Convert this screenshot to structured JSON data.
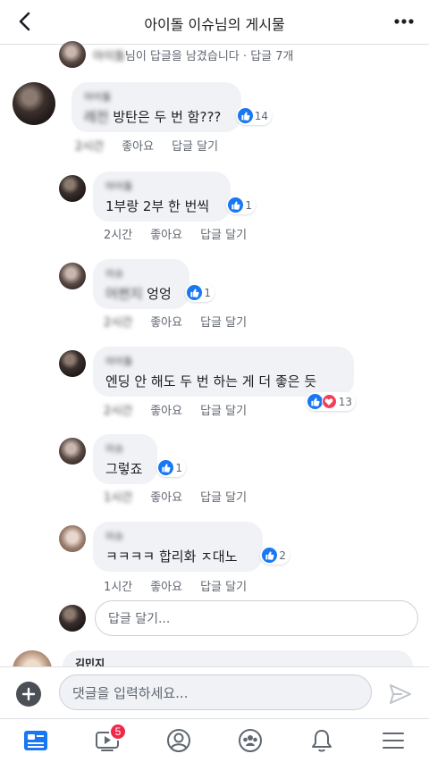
{
  "header": {
    "title": "아이돌 이슈님의 게시물"
  },
  "notice": {
    "blurred_name": "아이돌",
    "text": "님이 답글을 남겼습니다",
    "separator": "·",
    "replies": "답글 7개"
  },
  "comments": [
    {
      "name": "아이돌",
      "text_blur": "레전",
      "text": " 방탄은 두 번 함???",
      "reaction_count": "14",
      "reactions": [
        "like"
      ],
      "time": "2시간",
      "like_label": "좋아요",
      "reply_label": "답글 달기"
    },
    {
      "name": "아이돌",
      "text": "1부랑 2부 한 번씩",
      "reaction_count": "1",
      "reactions": [
        "like"
      ],
      "time": "2시간",
      "like_label": "좋아요",
      "reply_label": "답글 달기"
    },
    {
      "name": "이슈",
      "text_blur": "어쩐지",
      "text": " 엉엉",
      "reaction_count": "1",
      "reactions": [
        "like"
      ],
      "time": "2시간",
      "like_label": "좋아요",
      "reply_label": "답글 달기"
    },
    {
      "name": "아이돌",
      "text": "엔딩 안 해도 두 번 하는 게 더 좋은 듯",
      "reaction_count": "13",
      "reactions": [
        "like",
        "love"
      ],
      "time": "2시간",
      "like_label": "좋아요",
      "reply_label": "답글 달기"
    },
    {
      "name": "이슈",
      "text": "그렇죠",
      "reaction_count": "1",
      "reactions": [
        "like"
      ],
      "time": "1시간",
      "like_label": "좋아요",
      "reply_label": "답글 달기"
    },
    {
      "name": "이슈",
      "text": "ㅋㅋㅋㅋ 합리화 ㅈ대노",
      "reaction_count": "2",
      "reactions": [
        "like"
      ],
      "time": "1시간",
      "like_label": "좋아요",
      "reply_label": "답글 달기"
    }
  ],
  "reply_input": {
    "placeholder": "답글 달기..."
  },
  "next_comment": {
    "name": "김민지"
  },
  "composer": {
    "placeholder": "댓글을 입력하세요..."
  },
  "tabbar": {
    "video_badge": "5"
  },
  "colors": {
    "like_blue": "#1877f2",
    "love_red": "#f33e58",
    "badge_red": "#f02849"
  }
}
